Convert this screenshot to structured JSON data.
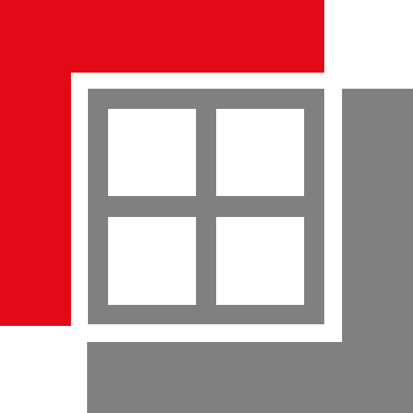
{
  "logo": {
    "icon": "window-frame-logo-icon",
    "colors": {
      "background": "#ffffff",
      "accent_red": "#e20a17",
      "frame_gray": "#808080",
      "pane": "#ffffff"
    },
    "panes": [
      {
        "name": "top-left"
      },
      {
        "name": "top-right"
      },
      {
        "name": "bottom-left"
      },
      {
        "name": "bottom-right"
      }
    ]
  }
}
